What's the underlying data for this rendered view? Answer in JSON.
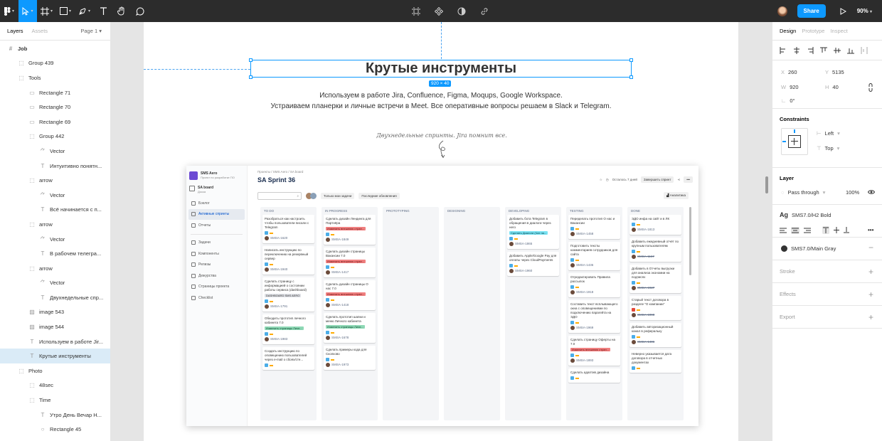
{
  "toolbar": {
    "share_label": "Share",
    "zoom": "90%"
  },
  "left_panel": {
    "tabs": [
      "Layers",
      "Assets"
    ],
    "page": "Page 1",
    "layers": [
      {
        "icon": "frame-icon",
        "label": "Job",
        "depth": 0,
        "bold": true
      },
      {
        "icon": "group-icon",
        "label": "Group 439",
        "depth": 1
      },
      {
        "icon": "group-icon",
        "label": "Tools",
        "depth": 1
      },
      {
        "icon": "rectangle-icon",
        "label": "Rectangle 71",
        "depth": 2
      },
      {
        "icon": "rectangle-icon",
        "label": "Rectangle 70",
        "depth": 2
      },
      {
        "icon": "rectangle-icon",
        "label": "Rectangle 69",
        "depth": 2
      },
      {
        "icon": "group-icon",
        "label": "Group 442",
        "depth": 2
      },
      {
        "icon": "vector-icon",
        "label": "Vector",
        "depth": 3
      },
      {
        "icon": "text-icon",
        "label": "Интуитивно понятн...",
        "depth": 3
      },
      {
        "icon": "group-icon",
        "label": "arrow",
        "depth": 2
      },
      {
        "icon": "vector-icon",
        "label": "Vector",
        "depth": 3
      },
      {
        "icon": "text-icon",
        "label": "Всё начинается с п...",
        "depth": 3
      },
      {
        "icon": "group-icon",
        "label": "arrow",
        "depth": 2
      },
      {
        "icon": "vector-icon",
        "label": "Vector",
        "depth": 3
      },
      {
        "icon": "text-icon",
        "label": "В рабочем телегра...",
        "depth": 3
      },
      {
        "icon": "group-icon",
        "label": "arrow",
        "depth": 2
      },
      {
        "icon": "vector-icon",
        "label": "Vector",
        "depth": 3
      },
      {
        "icon": "text-icon",
        "label": "Двухнедельные спр...",
        "depth": 3
      },
      {
        "icon": "image-icon",
        "label": "image 543",
        "depth": 2
      },
      {
        "icon": "image-icon",
        "label": "image 544",
        "depth": 2
      },
      {
        "icon": "text-icon",
        "label": "Используем в работе Jir...",
        "depth": 2
      },
      {
        "icon": "text-icon",
        "label": "Крутые инструменты",
        "depth": 2,
        "selected": true
      },
      {
        "icon": "group-icon",
        "label": "Photo",
        "depth": 1
      },
      {
        "icon": "group-icon",
        "label": "48sec",
        "depth": 2
      },
      {
        "icon": "group-icon",
        "label": "Time",
        "depth": 2
      },
      {
        "icon": "text-icon",
        "label": "Утро День Вечар Н...",
        "depth": 3
      },
      {
        "icon": "ellipse-icon",
        "label": "Rectangle 45",
        "depth": 3
      }
    ]
  },
  "canvas": {
    "title": "Крутые инструменты",
    "size_badge": "920 × 40",
    "subtitle_line1": "Используем в работе Jira, Confluence, Figma, Moqups, Google Workspace.",
    "subtitle_line2": "Устраиваем планерки и личные встречи в Meet. Все оперативные вопросы решаем в Slack и Telegram.",
    "note": "Двухнедельные спринты. Jira помнит все."
  },
  "jira": {
    "project_name": "SMS Aero",
    "project_sub": "Проект по разработке ПО",
    "sidebar": {
      "board_title": "SA board",
      "board_sub": "Доска",
      "items_top": [
        "Бэклог",
        "Активные спринты",
        "Отчеты"
      ],
      "items_bottom": [
        "Задачи",
        "Компоненты",
        "Релизы",
        "Дежурства",
        "Страницы проекта",
        "Checklist"
      ]
    },
    "breadcrumb": "Проекты / SMS Aero / SA board",
    "sprint_title": "SA Sprint 36",
    "days_left": "Осталось 7 дней",
    "complete_sprint": "Завершить спринт",
    "filter_mine": "Только мои задачи",
    "filter_recent": "Последние обновления",
    "analytics": "Аналитика",
    "columns": [
      {
        "name": "TO DO",
        "cards": [
          {
            "text": "Разобраться как настроить чтобы пользователи писали с Telegram",
            "key": "SMSA-1620"
          },
          {
            "text": "Написать инструкцию по переключению на резервный сервер",
            "key": "SMSA-1940"
          },
          {
            "text": "Сделать страницу с информацией о состоянии работы сервиса (dashboard)",
            "tag": "DASHBOARD SMS AERO",
            "tag_color": "grey",
            "key": "SMSA-1791"
          },
          {
            "text": "Обкодить прототип личного кабинета 7.0",
            "tag": "Изменить страницы Личн...",
            "tag_color": "green",
            "key": "SMSA-1983"
          },
          {
            "text": "Создать инструкцию по оповещению пользователей через e-mail о сбоях/сте...",
            "key": ""
          }
        ]
      },
      {
        "name": "IN PROGRESS",
        "cards": [
          {
            "text": "Сделать дизайн Лендинга для Партнёра",
            "tag": "Изменить внешнюю стран...",
            "tag_color": "red",
            "key": "SMSA-1849"
          },
          {
            "text": "Сделать дизайн страницы Вакансии 7.0",
            "tag": "Изменить внешнюю стран...",
            "tag_color": "red",
            "key": "SMSA-1417"
          },
          {
            "text": "Сделать дизайн страницы О нас 7.0",
            "tag": "Изменить внешнюю стран...",
            "tag_color": "red",
            "key": "SMSA-1418"
          },
          {
            "text": "Сделать прототип шапки и меню Личного кабинета",
            "tag": "Изменить страницы Личн...",
            "tag_color": "green",
            "key": "SMSA-1678"
          },
          {
            "text": "Сделать примеры кода для Сколково",
            "key": "SMSA-1973"
          }
        ]
      },
      {
        "name": "PROTOTYPING",
        "cards": []
      },
      {
        "name": "DESIGNING",
        "cards": []
      },
      {
        "name": "DEVELOPING",
        "cards": [
          {
            "text": "Добавить бота Telegram в обращения в диалоги через него",
            "tag": "Сделать Диалоги (Чат на...",
            "tag_color": "cyan",
            "key": "SMSA-1865"
          },
          {
            "text": "Добавить Apple/Google Pay для оплаты через CloudPayments",
            "key": "SMSA-1960"
          }
        ]
      },
      {
        "name": "TESTING",
        "cards": [
          {
            "text": "Переделать прототип О нас и Вакансии",
            "key": "SMSA-1458"
          },
          {
            "text": "Подготовить тексты комментариев сотрудников для сайта",
            "key": "SMSA-1436"
          },
          {
            "text": "Отредактировать Правила рассылок",
            "key": "SMSA-1918"
          },
          {
            "text": "Составить текст всплывающего окна с оповещениями по подключению парагейта на ЭДО",
            "key": "SMSA-1969"
          },
          {
            "text": "Сделать страницу Оферты на 7.0",
            "tag": "Изменить внешнюю стран...",
            "tag_color": "red",
            "key": "SMSA-1893"
          },
          {
            "text": "Сделать адаптив дизайна",
            "key": ""
          }
        ]
      },
      {
        "name": "DONE",
        "cards": [
          {
            "text": "ЭДО инфа на сайт и в ЛК",
            "key": "SMSA-1813"
          },
          {
            "text": "Добавить ежедневный отчёт по крупным пользователям",
            "key": "SMSA-1167",
            "strike": true
          },
          {
            "text": "Добавить в Отчеты выгрузки для анализа экономии на подписях",
            "key": "SMSA-1927",
            "strike": true
          },
          {
            "text": "Старый текст договора в разделе \"О компании\"",
            "key": "SMSA-1098",
            "strike": true
          },
          {
            "text": "Добавить авторизационный канал в реферальку",
            "key": "SMSA-1406",
            "strike": true
          },
          {
            "text": "Неверно указывается дата договора в отчетных документах",
            "key": ""
          }
        ]
      }
    ]
  },
  "right_panel": {
    "tabs": [
      "Design",
      "Prototype",
      "Inspect"
    ],
    "x_label": "X",
    "x": "260",
    "y_label": "Y",
    "y": "5135",
    "w_label": "W",
    "w": "920",
    "h_label": "H",
    "h": "40",
    "rotation": "0°",
    "constraints_title": "Constraints",
    "constraint_h": "Left",
    "constraint_v": "Top",
    "layer_title": "Layer",
    "blend": "Pass through",
    "opacity": "100%",
    "text_style": "SMS7.0/H2 Bold",
    "fill_style": "SMS7.0/Main Gray",
    "stroke": "Stroke",
    "effects": "Effects",
    "export": "Export"
  }
}
